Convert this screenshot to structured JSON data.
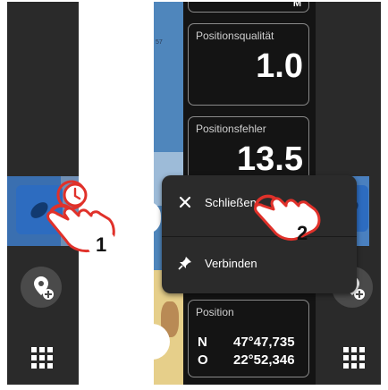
{
  "left": {
    "grid_label": "Apps",
    "callout_number": "1"
  },
  "center": {
    "top_badge": "M",
    "map_number": "57",
    "quality": {
      "label": "Positionsqualität",
      "value": "1.0"
    },
    "error": {
      "label": "Positionsfehler",
      "value": "13.5"
    },
    "position": {
      "label": "Position",
      "lat_prefix": "N",
      "lat_value": "47°47,735",
      "lon_prefix": "O",
      "lon_value": "22°52,346"
    }
  },
  "menu": {
    "close_label": "Schließen",
    "connect_label": "Verbinden"
  },
  "callout_number_2": "2",
  "colors": {
    "accent_red": "#e0312a",
    "panel_dark": "#1f1f1f",
    "chart_blue": "#2d6cc0"
  }
}
